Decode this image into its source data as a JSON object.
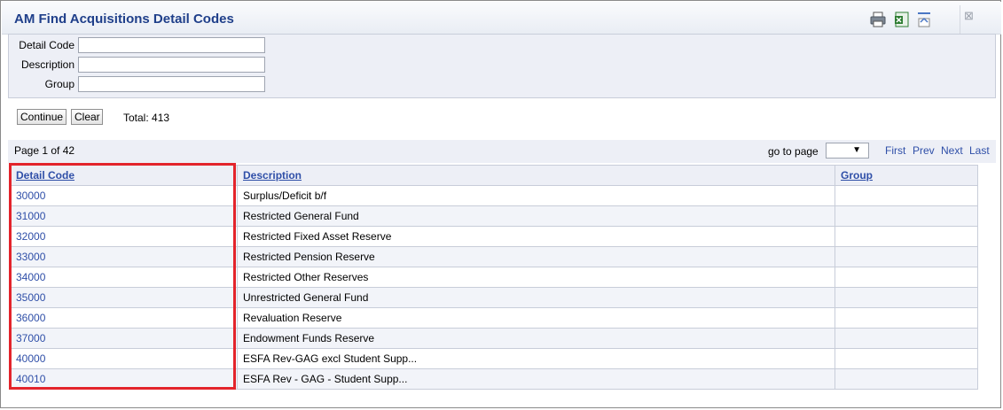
{
  "window": {
    "title": "AM Find Acquisitions Detail Codes"
  },
  "toolbar": {
    "icons": [
      "print-icon",
      "excel-export-icon",
      "collapse-icon",
      "close-icon"
    ],
    "close_glyph": "⊠"
  },
  "search": {
    "fields": [
      {
        "label": "Detail Code",
        "value": ""
      },
      {
        "label": "Description",
        "value": ""
      },
      {
        "label": "Group",
        "value": ""
      }
    ],
    "continue_label": "Continue",
    "clear_label": "Clear",
    "total": "Total: 413"
  },
  "pager": {
    "info": "Page 1 of 42",
    "goto_label": "go to page",
    "goto_arrow": "▼",
    "first": "First",
    "prev": "Prev",
    "next": "Next",
    "last": "Last"
  },
  "table": {
    "headers": [
      "Detail Code",
      "Description",
      "Group"
    ],
    "rows": [
      {
        "code": "30000",
        "description": "Surplus/Deficit b/f",
        "group": ""
      },
      {
        "code": "31000",
        "description": "Restricted General Fund",
        "group": ""
      },
      {
        "code": "32000",
        "description": "Restricted Fixed Asset Reserve",
        "group": ""
      },
      {
        "code": "33000",
        "description": "Restricted Pension Reserve",
        "group": ""
      },
      {
        "code": "34000",
        "description": "Restricted Other Reserves",
        "group": ""
      },
      {
        "code": "35000",
        "description": "Unrestricted General Fund",
        "group": ""
      },
      {
        "code": "36000",
        "description": "Revaluation Reserve",
        "group": ""
      },
      {
        "code": "37000",
        "description": "Endowment Funds Reserve",
        "group": ""
      },
      {
        "code": "40000",
        "description": "ESFA Rev-GAG excl Student Supp...",
        "group": ""
      },
      {
        "code": "40010",
        "description": "ESFA Rev - GAG - Student Supp...",
        "group": ""
      }
    ]
  },
  "colors": {
    "title": "#1f3f8a",
    "link": "#2f4fa8",
    "highlight": "#e3242b",
    "panel": "#edeff6"
  }
}
